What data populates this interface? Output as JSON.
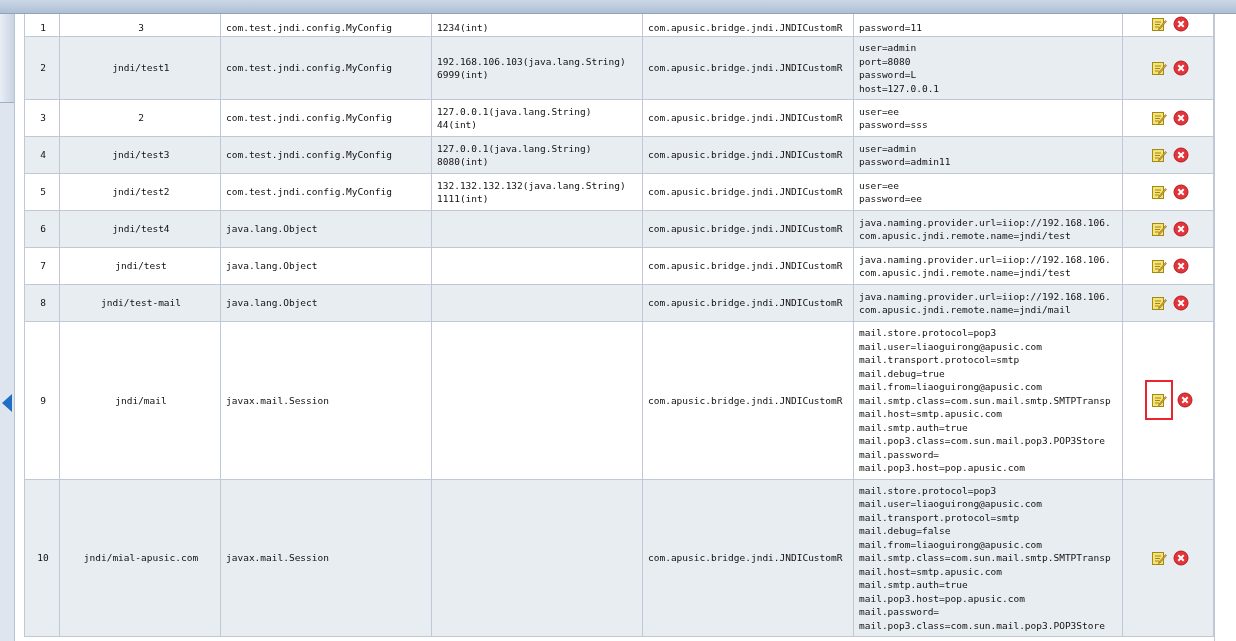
{
  "table": {
    "rows": [
      {
        "index": "1",
        "name": "3",
        "class": "com.test.jndi.config.MyConfig",
        "values": [
          "1234(int)"
        ],
        "factory": "com.apusic.bridge.jndi.JNDICustomR",
        "properties": [
          "password=11"
        ],
        "highlighted": false
      },
      {
        "index": "2",
        "name": "jndi/test1",
        "class": "com.test.jndi.config.MyConfig",
        "values": [
          "192.168.106.103(java.lang.String)",
          "6999(int)"
        ],
        "factory": "com.apusic.bridge.jndi.JNDICustomR",
        "properties": [
          "user=admin",
          "port=8080",
          "password=L",
          "host=127.0.0.1"
        ],
        "highlighted": false
      },
      {
        "index": "3",
        "name": "2",
        "class": "com.test.jndi.config.MyConfig",
        "values": [
          "127.0.0.1(java.lang.String)",
          "44(int)"
        ],
        "factory": "com.apusic.bridge.jndi.JNDICustomR",
        "properties": [
          "user=ee",
          "password=sss"
        ],
        "highlighted": false
      },
      {
        "index": "4",
        "name": "jndi/test3",
        "class": "com.test.jndi.config.MyConfig",
        "values": [
          "127.0.0.1(java.lang.String)",
          "8080(int)"
        ],
        "factory": "com.apusic.bridge.jndi.JNDICustomR",
        "properties": [
          "user=admin",
          "password=admin11"
        ],
        "highlighted": false
      },
      {
        "index": "5",
        "name": "jndi/test2",
        "class": "com.test.jndi.config.MyConfig",
        "values": [
          "132.132.132.132(java.lang.String)",
          "1111(int)"
        ],
        "factory": "com.apusic.bridge.jndi.JNDICustomR",
        "properties": [
          "user=ee",
          "password=ee"
        ],
        "highlighted": false
      },
      {
        "index": "6",
        "name": "jndi/test4",
        "class": "java.lang.Object",
        "values": [],
        "factory": "com.apusic.bridge.jndi.JNDICustomR",
        "properties": [
          "java.naming.provider.url=iiop://192.168.106.",
          "com.apusic.jndi.remote.name=jndi/test"
        ],
        "highlighted": false
      },
      {
        "index": "7",
        "name": "jndi/test",
        "class": "java.lang.Object",
        "values": [],
        "factory": "com.apusic.bridge.jndi.JNDICustomR",
        "properties": [
          "java.naming.provider.url=iiop://192.168.106.",
          "com.apusic.jndi.remote.name=jndi/test"
        ],
        "highlighted": false
      },
      {
        "index": "8",
        "name": "jndi/test-mail",
        "class": "java.lang.Object",
        "values": [],
        "factory": "com.apusic.bridge.jndi.JNDICustomR",
        "properties": [
          "java.naming.provider.url=iiop://192.168.106.",
          "com.apusic.jndi.remote.name=jndi/mail"
        ],
        "highlighted": false
      },
      {
        "index": "9",
        "name": "jndi/mail",
        "class": "javax.mail.Session",
        "values": [],
        "factory": "com.apusic.bridge.jndi.JNDICustomR",
        "properties": [
          "mail.store.protocol=pop3",
          "mail.user=liaoguirong@apusic.com",
          "mail.transport.protocol=smtp",
          "mail.debug=true",
          "mail.from=liaoguirong@apusic.com",
          "mail.smtp.class=com.sun.mail.smtp.SMTPTransp",
          "mail.host=smtp.apusic.com",
          "mail.smtp.auth=true",
          "mail.pop3.class=com.sun.mail.pop3.POP3Store",
          "mail.password=",
          "mail.pop3.host=pop.apusic.com"
        ],
        "highlighted": true
      },
      {
        "index": "10",
        "name": "jndi/mial-apusic.com",
        "class": "javax.mail.Session",
        "values": [],
        "factory": "com.apusic.bridge.jndi.JNDICustomR",
        "properties": [
          "mail.store.protocol=pop3",
          "mail.user=liaoguirong@apusic.com",
          "mail.transport.protocol=smtp",
          "mail.debug=false",
          "mail.from=liaoguirong@apusic.com",
          "mail.smtp.class=com.sun.mail.smtp.SMTPTransp",
          "mail.host=smtp.apusic.com",
          "mail.smtp.auth=true",
          "mail.pop3.host=pop.apusic.com",
          "mail.password=",
          "mail.pop3.class=com.sun.mail.pop3.POP3Store"
        ],
        "highlighted": false
      }
    ]
  }
}
